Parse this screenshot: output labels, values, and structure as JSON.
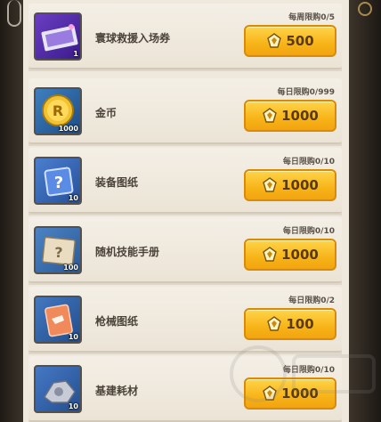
{
  "shop": {
    "items": [
      {
        "name": "寰球救援入场券",
        "limit": "每周限购0/5",
        "price": "500",
        "qty": "1"
      },
      {
        "name": "金币",
        "limit": "每日限购0/999",
        "price": "1000",
        "qty": "1000"
      },
      {
        "name": "装备图纸",
        "limit": "每日限购0/10",
        "price": "1000",
        "qty": "10"
      },
      {
        "name": "随机技能手册",
        "limit": "每日限购0/10",
        "price": "1000",
        "qty": "100"
      },
      {
        "name": "枪械图纸",
        "limit": "每日限购0/2",
        "price": "100",
        "qty": "10"
      },
      {
        "name": "基建耗材",
        "limit": "每日限购0/10",
        "price": "1000",
        "qty": "10"
      }
    ],
    "currency_icon": "gem-currency-icon",
    "accent_color": "#f7b418"
  }
}
